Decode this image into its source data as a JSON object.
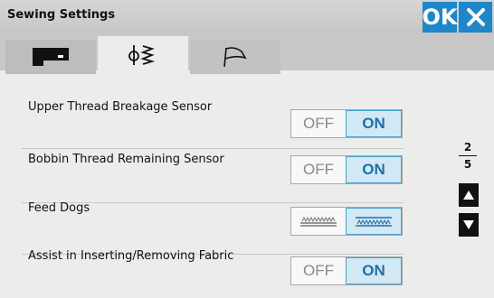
{
  "header": {
    "title": "Sewing Settings",
    "ok_label": "OK"
  },
  "tabs": [
    {
      "icon": "sewing-machine-icon"
    },
    {
      "icon": "thread-tension-icon"
    },
    {
      "icon": "flag-icon"
    }
  ],
  "settings": [
    {
      "label": "Upper Thread Breakage Sensor",
      "off": "OFF",
      "on": "ON",
      "selected": "ON"
    },
    {
      "label": "Bobbin Thread Remaining Sensor",
      "off": "OFF",
      "on": "ON",
      "selected": "ON"
    },
    {
      "label": "Feed Dogs",
      "off_icon": "feed-dogs-down-icon",
      "on_icon": "feed-dogs-up-icon",
      "selected": "up"
    },
    {
      "label": "Assist in Inserting/Removing Fabric",
      "off": "OFF",
      "on": "ON",
      "selected": "ON"
    }
  ],
  "pager": {
    "current": "2",
    "total": "5"
  },
  "colors": {
    "accent": "#1f87c8",
    "selected_bg": "#d2e8f4"
  }
}
